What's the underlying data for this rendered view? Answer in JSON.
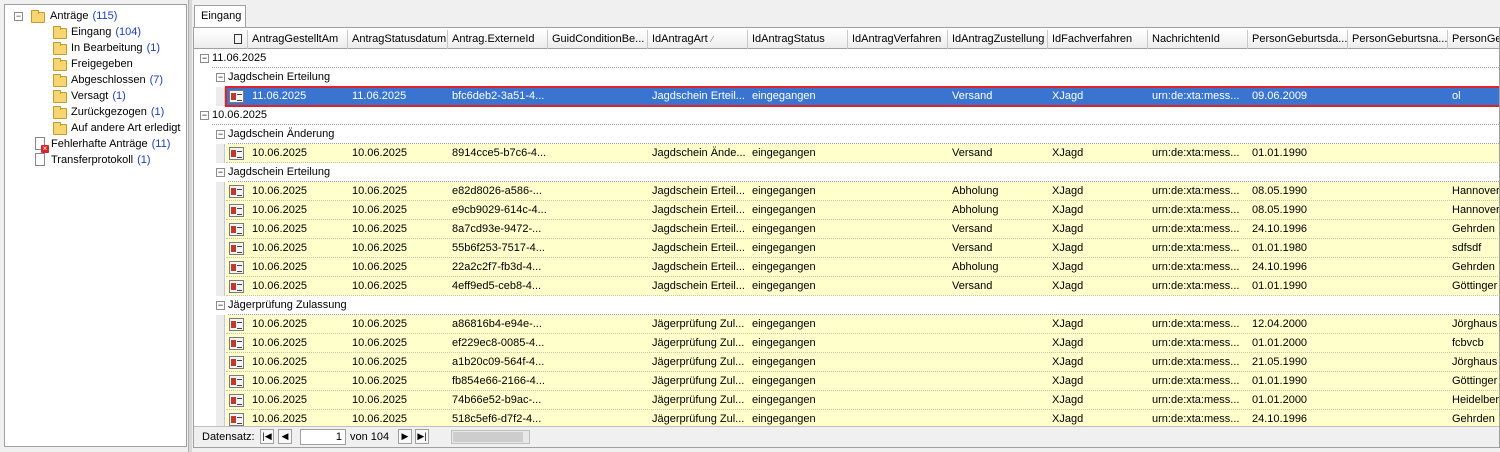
{
  "tree": {
    "root": {
      "label": "Anträge",
      "count": "(115)"
    },
    "children": [
      {
        "label": "Eingang",
        "count": "(104)"
      },
      {
        "label": "In Bearbeitung",
        "count": "(1)"
      },
      {
        "label": "Freigegeben",
        "count": ""
      },
      {
        "label": "Abgeschlossen",
        "count": "(7)"
      },
      {
        "label": "Versagt",
        "count": "(1)"
      },
      {
        "label": "Zurückgezogen",
        "count": "(1)"
      },
      {
        "label": "Auf andere Art erledigt",
        "count": ""
      }
    ],
    "faulty": {
      "label": "Fehlerhafte Anträge",
      "count": "(11)"
    },
    "transfer": {
      "label": "Transferprotokoll",
      "count": "(1)"
    }
  },
  "tab": {
    "label": "Eingang"
  },
  "columns": [
    "AntragGestelltAm",
    "AntragStatusdatum",
    "Antrag.ExterneId",
    "GuidConditionBe...",
    "IdAntragArt",
    "IdAntragStatus",
    "IdAntragVerfahren",
    "IdAntragZustellung",
    "IdFachverfahren",
    "NachrichtenId",
    "PersonGeburtsda...",
    "PersonGeburtsna...",
    "PersonGe"
  ],
  "groups": {
    "g1": {
      "date": "11.06.2025",
      "sub1": "Jagdschein Erteilung"
    },
    "g2": {
      "date": "10.06.2025",
      "sub1": "Jagdschein Änderung",
      "sub2": "Jagdschein Erteilung",
      "sub3": "Jägerprüfung Zulassung"
    }
  },
  "rows": [
    [
      "11.06.2025",
      "11.06.2025",
      "bfc6deb2-3a51-4...",
      "",
      "Jagdschein Erteil...",
      "eingegangen",
      "",
      "Versand",
      "XJagd",
      "urn:de:xta:mess...",
      "09.06.2009",
      "",
      "ol"
    ],
    [
      "10.06.2025",
      "10.06.2025",
      "8914cce5-b7c6-4...",
      "",
      "Jagdschein Ände...",
      "eingegangen",
      "",
      "Versand",
      "XJagd",
      "urn:de:xta:mess...",
      "01.01.1990",
      "",
      ""
    ],
    [
      "10.06.2025",
      "10.06.2025",
      "e82d8026-a586-...",
      "",
      "Jagdschein Erteil...",
      "eingegangen",
      "",
      "Abholung",
      "XJagd",
      "urn:de:xta:mess...",
      "08.05.1990",
      "",
      "Hannover"
    ],
    [
      "10.06.2025",
      "10.06.2025",
      "e9cb9029-614c-4...",
      "",
      "Jagdschein Erteil...",
      "eingegangen",
      "",
      "Abholung",
      "XJagd",
      "urn:de:xta:mess...",
      "08.05.1990",
      "",
      "Hannover"
    ],
    [
      "10.06.2025",
      "10.06.2025",
      "8a7cd93e-9472-...",
      "",
      "Jagdschein Erteil...",
      "eingegangen",
      "",
      "Versand",
      "XJagd",
      "urn:de:xta:mess...",
      "24.10.1996",
      "",
      "Gehrden"
    ],
    [
      "10.06.2025",
      "10.06.2025",
      "55b6f253-7517-4...",
      "",
      "Jagdschein Erteil...",
      "eingegangen",
      "",
      "Versand",
      "XJagd",
      "urn:de:xta:mess...",
      "01.01.1980",
      "",
      "sdfsdf"
    ],
    [
      "10.06.2025",
      "10.06.2025",
      "22a2c2f7-fb3d-4...",
      "",
      "Jagdschein Erteil...",
      "eingegangen",
      "",
      "Abholung",
      "XJagd",
      "urn:de:xta:mess...",
      "24.10.1996",
      "",
      "Gehrden"
    ],
    [
      "10.06.2025",
      "10.06.2025",
      "4eff9ed5-ceb8-4...",
      "",
      "Jagdschein Erteil...",
      "eingegangen",
      "",
      "Versand",
      "XJagd",
      "urn:de:xta:mess...",
      "01.01.1990",
      "",
      "Göttinger"
    ],
    [
      "10.06.2025",
      "10.06.2025",
      "a86816b4-e94e-...",
      "",
      "Jägerprüfung Zul...",
      "eingegangen",
      "",
      "",
      "XJagd",
      "urn:de:xta:mess...",
      "12.04.2000",
      "",
      "Jörghaus"
    ],
    [
      "10.06.2025",
      "10.06.2025",
      "ef229ec8-0085-4...",
      "",
      "Jägerprüfung Zul...",
      "eingegangen",
      "",
      "",
      "XJagd",
      "urn:de:xta:mess...",
      "01.01.2000",
      "",
      "fcbvcb"
    ],
    [
      "10.06.2025",
      "10.06.2025",
      "a1b20c09-564f-4...",
      "",
      "Jägerprüfung Zul...",
      "eingegangen",
      "",
      "",
      "XJagd",
      "urn:de:xta:mess...",
      "21.05.1990",
      "",
      "Jörghaus"
    ],
    [
      "10.06.2025",
      "10.06.2025",
      "fb854e66-2166-4...",
      "",
      "Jägerprüfung Zul...",
      "eingegangen",
      "",
      "",
      "XJagd",
      "urn:de:xta:mess...",
      "01.01.1990",
      "",
      "Göttinger"
    ],
    [
      "10.06.2025",
      "10.06.2025",
      "74b66e52-b9ac-...",
      "",
      "Jägerprüfung Zul...",
      "eingegangen",
      "",
      "",
      "XJagd",
      "urn:de:xta:mess...",
      "01.01.2000",
      "",
      "Heidelber"
    ],
    [
      "10.06.2025",
      "10.06.2025",
      "518c5ef6-d7f2-4...",
      "",
      "Jägerprüfung Zul...",
      "eingegangen",
      "",
      "",
      "XJagd",
      "urn:de:xta:mess...",
      "24.10.1996",
      "",
      "Gehrden"
    ]
  ],
  "nav": {
    "label": "Datensatz:",
    "current": "1",
    "of_label": "von 104"
  },
  "colors": {
    "row_bg": "#ffffcc",
    "selected_bg": "#3874d0",
    "selected_outline": "#e0232a"
  }
}
